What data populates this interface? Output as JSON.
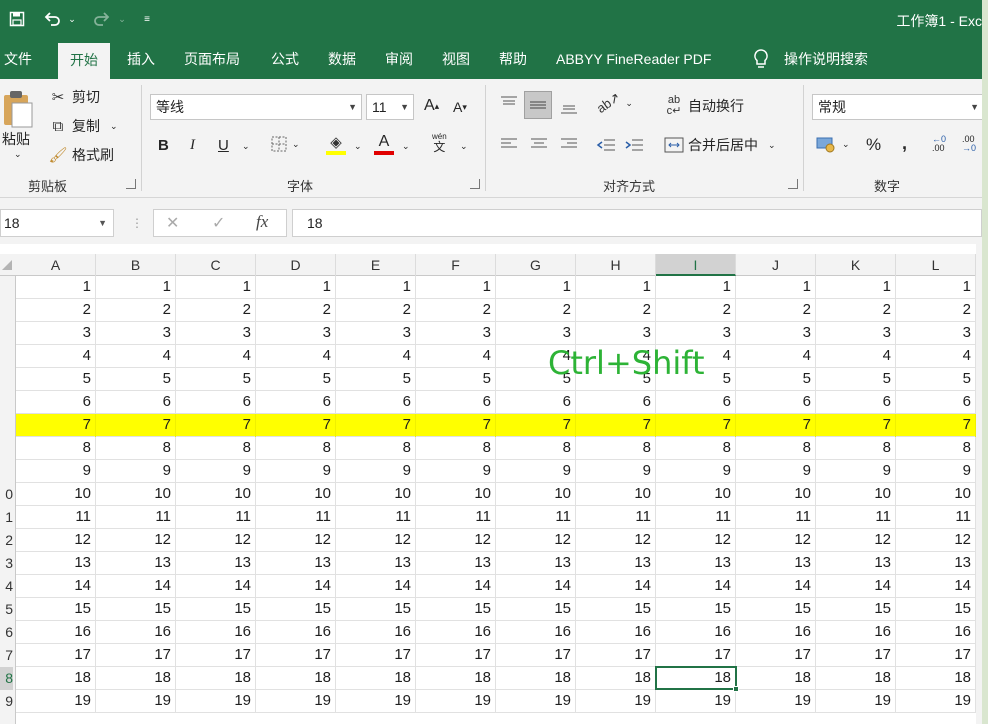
{
  "titlebar": {
    "workbook_title": "工作簿1 - Exc",
    "icons": [
      "save-icon",
      "undo-icon",
      "redo-icon",
      "customize-icon"
    ]
  },
  "tabs": [
    {
      "label": "文件",
      "active": false
    },
    {
      "label": "开始",
      "active": true
    },
    {
      "label": "插入",
      "active": false
    },
    {
      "label": "页面布局",
      "active": false
    },
    {
      "label": "公式",
      "active": false
    },
    {
      "label": "数据",
      "active": false
    },
    {
      "label": "审阅",
      "active": false
    },
    {
      "label": "视图",
      "active": false
    },
    {
      "label": "帮助",
      "active": false
    },
    {
      "label": "ABBYY FineReader PDF",
      "active": false
    }
  ],
  "tell_me": "操作说明搜索",
  "ribbon": {
    "clipboard": {
      "paste": "粘贴",
      "cut": "剪切",
      "copy": "复制",
      "format_painter": "格式刷",
      "label": "剪贴板"
    },
    "font": {
      "name": "等线",
      "size": "11",
      "bold": "B",
      "italic": "I",
      "underline": "U",
      "font_color_letter": "A",
      "label": "字体",
      "wen": "wén",
      "wen_char": "文",
      "grow": "A",
      "shrink": "A"
    },
    "alignment": {
      "wrap": "自动换行",
      "merge": "合并后居中",
      "label": "对齐方式"
    },
    "number": {
      "format": "常规",
      "percent": "%",
      "comma": ",",
      "inc_decimal": ".00",
      "dec_decimal": ".00",
      "label": "数字"
    }
  },
  "formula_bar": {
    "name_box": "18",
    "cancel": "✕",
    "enter": "✓",
    "fx": "fx",
    "value": "18"
  },
  "columns": [
    {
      "name": "A",
      "selected": false
    },
    {
      "name": "B",
      "selected": false
    },
    {
      "name": "C",
      "selected": false
    },
    {
      "name": "D",
      "selected": false
    },
    {
      "name": "E",
      "selected": false
    },
    {
      "name": "F",
      "selected": false
    },
    {
      "name": "G",
      "selected": false
    },
    {
      "name": "H",
      "selected": false
    },
    {
      "name": "I",
      "selected": true
    },
    {
      "name": "J",
      "selected": false
    },
    {
      "name": "K",
      "selected": false
    },
    {
      "name": "L",
      "selected": false
    }
  ],
  "rows": [
    {
      "header": "",
      "value": "1",
      "highlight": false,
      "selected": false
    },
    {
      "header": "",
      "value": "2",
      "highlight": false,
      "selected": false
    },
    {
      "header": "",
      "value": "3",
      "highlight": false,
      "selected": false
    },
    {
      "header": "",
      "value": "4",
      "highlight": false,
      "selected": false
    },
    {
      "header": "",
      "value": "5",
      "highlight": false,
      "selected": false
    },
    {
      "header": "",
      "value": "6",
      "highlight": false,
      "selected": false
    },
    {
      "header": "",
      "value": "7",
      "highlight": true,
      "selected": false
    },
    {
      "header": "",
      "value": "8",
      "highlight": false,
      "selected": false
    },
    {
      "header": "",
      "value": "9",
      "highlight": false,
      "selected": false
    },
    {
      "header": "0",
      "value": "10",
      "highlight": false,
      "selected": false
    },
    {
      "header": "1",
      "value": "11",
      "highlight": false,
      "selected": false
    },
    {
      "header": "2",
      "value": "12",
      "highlight": false,
      "selected": false
    },
    {
      "header": "3",
      "value": "13",
      "highlight": false,
      "selected": false
    },
    {
      "header": "4",
      "value": "14",
      "highlight": false,
      "selected": false
    },
    {
      "header": "5",
      "value": "15",
      "highlight": false,
      "selected": false
    },
    {
      "header": "6",
      "value": "16",
      "highlight": false,
      "selected": false
    },
    {
      "header": "7",
      "value": "17",
      "highlight": false,
      "selected": false
    },
    {
      "header": "8",
      "value": "18",
      "highlight": false,
      "selected": true
    },
    {
      "header": "9",
      "value": "19",
      "highlight": false,
      "selected": false
    }
  ],
  "active_cell": {
    "column_index": 8,
    "row_index": 17
  },
  "overlay_text": "Ctrl+Shift",
  "colors": {
    "accent": "#217346",
    "highlight_row": "#ffff00",
    "overlay": "#2db336"
  }
}
